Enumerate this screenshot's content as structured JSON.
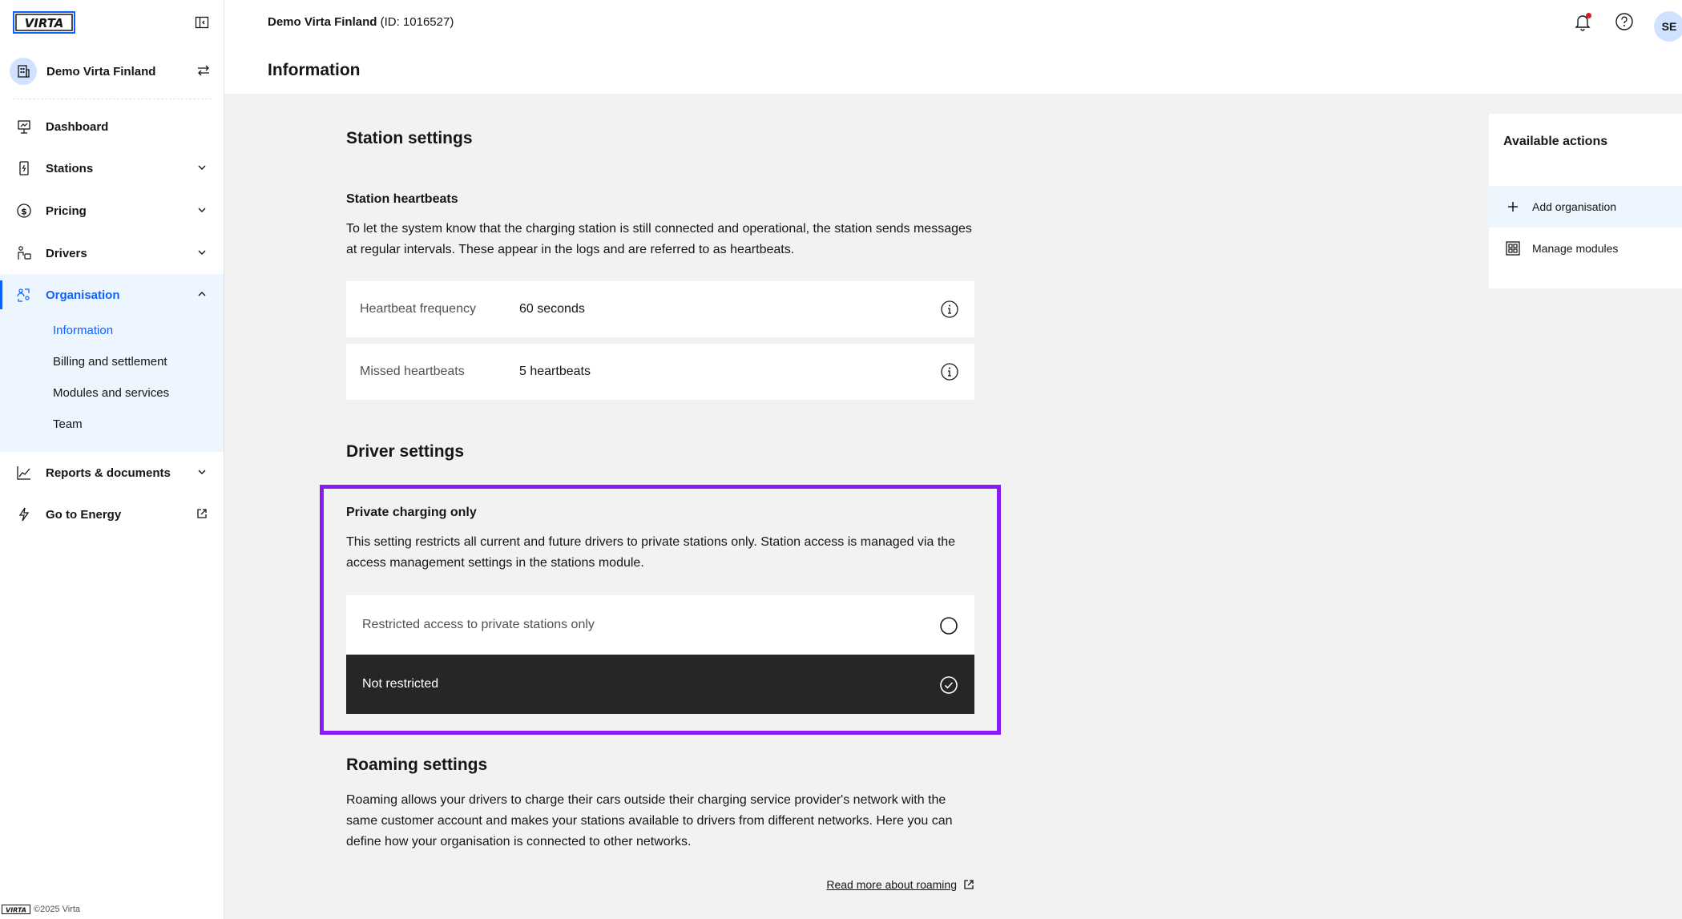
{
  "brand": {
    "logo_text": "VIRTA",
    "accent": "#0f62fe",
    "highlight_color": "#8a1cf3"
  },
  "sidebar": {
    "org_name": "Demo Virta Finland",
    "items": [
      {
        "label": "Dashboard",
        "icon": "dashboard-icon"
      },
      {
        "label": "Stations",
        "icon": "station-icon"
      },
      {
        "label": "Pricing",
        "icon": "dollar-icon"
      },
      {
        "label": "Drivers",
        "icon": "drivers-icon"
      },
      {
        "label": "Organisation",
        "icon": "organisation-icon"
      },
      {
        "label": "Reports & documents",
        "icon": "chart-icon"
      },
      {
        "label": "Go to Energy",
        "icon": "lightning-icon"
      }
    ],
    "org_subitems": [
      "Information",
      "Billing and settlement",
      "Modules and services",
      "Team"
    ],
    "footer": "©2025 Virta"
  },
  "header": {
    "org_name": "Demo Virta Finland",
    "org_id": "(ID: 1016527)",
    "page_title": "Information",
    "user_initials": "SE"
  },
  "main": {
    "station_settings": {
      "title": "Station settings",
      "heartbeats_title": "Station heartbeats",
      "heartbeats_desc": "To let the system know that the charging station is still connected and operational, the station sends messages at regular intervals. These appear in the logs and are referred to as heartbeats.",
      "rows": [
        {
          "label": "Heartbeat frequency",
          "value": "60 seconds"
        },
        {
          "label": "Missed heartbeats",
          "value": "5 heartbeats"
        }
      ]
    },
    "driver_settings": {
      "title": "Driver settings",
      "private_title": "Private charging only",
      "private_desc": "This setting restricts all current and future drivers to private stations only. Station access is managed via the access management settings in the stations module.",
      "options": [
        {
          "label": "Restricted access to private stations only",
          "selected": false
        },
        {
          "label": "Not restricted",
          "selected": true
        }
      ]
    },
    "roaming_settings": {
      "title": "Roaming settings",
      "desc": "Roaming allows your drivers to charge their cars outside their charging service provider's network with the same customer account and makes your stations available to drivers from different networks. Here you can define how your organisation is connected to other networks.",
      "link": "Read more about roaming"
    }
  },
  "actions": {
    "title": "Available actions",
    "items": [
      {
        "label": "Add organisation",
        "icon": "plus-icon"
      },
      {
        "label": "Manage modules",
        "icon": "modules-icon"
      }
    ]
  }
}
